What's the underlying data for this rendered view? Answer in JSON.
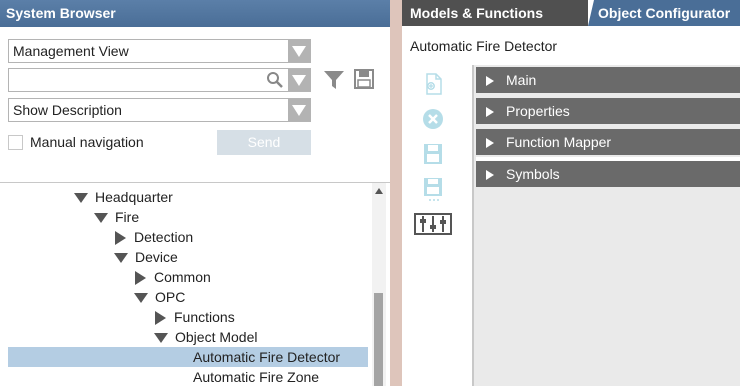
{
  "left_panel": {
    "title": "System Browser",
    "view_select": {
      "value": "Management View"
    },
    "search": {
      "value": ""
    },
    "description_select": {
      "value": "Show Description"
    },
    "manual_navigation": {
      "label": "Manual navigation",
      "checked": false
    },
    "send_button": {
      "label": "Send",
      "enabled": false
    },
    "tree": [
      {
        "label": "Headquarter",
        "expanded": true,
        "level": 0
      },
      {
        "label": "Fire",
        "expanded": true,
        "level": 1
      },
      {
        "label": "Detection",
        "expanded": false,
        "level": 2
      },
      {
        "label": "Device",
        "expanded": true,
        "level": 2
      },
      {
        "label": "Common",
        "expanded": false,
        "level": 3
      },
      {
        "label": "OPC",
        "expanded": true,
        "level": 3
      },
      {
        "label": "Functions",
        "expanded": false,
        "level": 4
      },
      {
        "label": "Object Model",
        "expanded": true,
        "level": 4
      },
      {
        "label": "Automatic Fire Detector",
        "level": 5,
        "selected": true
      },
      {
        "label": "Automatic Fire Zone",
        "level": 5
      }
    ]
  },
  "right_panel": {
    "tabs": [
      {
        "label": "Models & Functions",
        "active": true
      },
      {
        "label": "Object Configurator",
        "active": false
      }
    ],
    "object_title": "Automatic Fire Detector",
    "toolbar_icons": [
      "new-document-icon",
      "delete-icon",
      "save-icon",
      "save-as-icon",
      "properties-sliders-icon"
    ],
    "sections": [
      {
        "label": "Main"
      },
      {
        "label": "Properties"
      },
      {
        "label": "Function Mapper"
      },
      {
        "label": "Symbols"
      }
    ]
  },
  "colors": {
    "header_blue": "#4a6e97",
    "tab_dark": "#505050",
    "section_gray": "#6a6a6a",
    "selection": "#b4cde3",
    "disabled_icon": "#b5dde8"
  }
}
